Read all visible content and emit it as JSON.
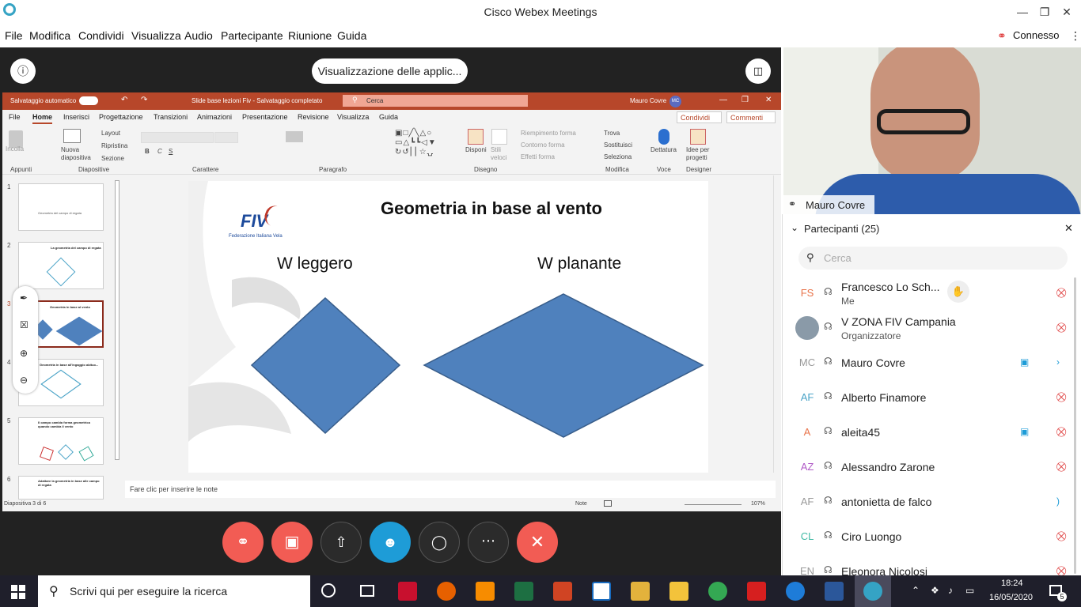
{
  "window": {
    "title": "Cisco Webex Meetings",
    "status": "Connesso"
  },
  "menu": [
    "File",
    "Modifica",
    "Condividi",
    "Visualizza",
    "Audio",
    "Partecipante",
    "Riunione",
    "Guida"
  ],
  "share": {
    "banner": "Visualizzazione delle applic..."
  },
  "ppt": {
    "autosave": "Salvataggio automatico",
    "doc_title": "Slide base lezioni Fiv - Salvataggio completato",
    "search_placeholder": "Cerca",
    "user": "Mauro Covre",
    "user_initials": "MC",
    "tabs": [
      "File",
      "Home",
      "Inserisci",
      "Progettazione",
      "Transizioni",
      "Animazioni",
      "Presentazione",
      "Revisione",
      "Visualizza",
      "Guida"
    ],
    "share_btn": "Condividi",
    "comments_btn": "Commenti",
    "groups": [
      "Appunti",
      "Diapositive",
      "Carattere",
      "Paragrafo",
      "Disegno",
      "Modifica",
      "Voce",
      "Designer"
    ],
    "ribbon": {
      "incolla": "Incolla",
      "nuova": "Nuova diapositiva",
      "layout": "Layout",
      "ripristina": "Ripristina",
      "sezione": "Sezione",
      "disponi": "Disponi",
      "stili": "Stili veloci",
      "riempimento": "Riempimento forma",
      "contorno": "Contorno forma",
      "effetti": "Effetti forma",
      "trova": "Trova",
      "sostituisci": "Sostituisci",
      "seleziona": "Seleziona",
      "dettatura": "Dettatura",
      "idee": "Idee per progetti"
    },
    "slide_nums": [
      "1",
      "2",
      "3",
      "4",
      "5",
      "6"
    ],
    "thumb_titles": [
      "Geometria del campo di regata",
      "La geometria del campo di regata",
      "Geometria in base al vento",
      "Geometria in base all'ingaggio abituo...",
      "Il campo cambia forma geometrica quando cambia il vento",
      "Adattare la geometria in base alle campo di regata"
    ],
    "slide": {
      "title": "Geometria in base al vento",
      "logo": "FIV",
      "logo_sub": "Federazione Italiana Vela",
      "left_label": "W leggero",
      "right_label": "W planante"
    },
    "notes_placeholder": "Fare clic per inserire le note",
    "status_left": "Diapositiva 3 di 6",
    "notes_btn": "Note",
    "zoom": "107%"
  },
  "video": {
    "name": "Mauro Covre"
  },
  "participants": {
    "header": "Partecipanti (25)",
    "search_placeholder": "Cerca",
    "list": [
      {
        "initials": "FS",
        "name": "Francesco Lo Sch...",
        "sub": "Me",
        "color": "#e8734a"
      },
      {
        "initials": "",
        "name": "V ZONA FIV Campania",
        "sub": "Organizzatore",
        "color": "#777"
      },
      {
        "initials": "MC",
        "name": "Mauro Covre",
        "sub": "",
        "color": "#9a9a9a"
      },
      {
        "initials": "AF",
        "name": "Alberto Finamore",
        "sub": "",
        "color": "#4aa3c7"
      },
      {
        "initials": "A",
        "name": "aleita45",
        "sub": "",
        "color": "#e8734a"
      },
      {
        "initials": "AZ",
        "name": "Alessandro Zarone",
        "sub": "",
        "color": "#b05ac7"
      },
      {
        "initials": "AF",
        "name": "antonietta de falco",
        "sub": "",
        "color": "#9a9a9a"
      },
      {
        "initials": "CL",
        "name": "Ciro Luongo",
        "sub": "",
        "color": "#3fb9a4"
      },
      {
        "initials": "EN",
        "name": "Eleonora Nicolosi",
        "sub": "",
        "color": "#9a9a9a"
      }
    ]
  },
  "taskbar": {
    "search": "Scrivi qui per eseguire la ricerca",
    "time": "18:24",
    "date": "16/05/2020",
    "notifications": "5"
  }
}
